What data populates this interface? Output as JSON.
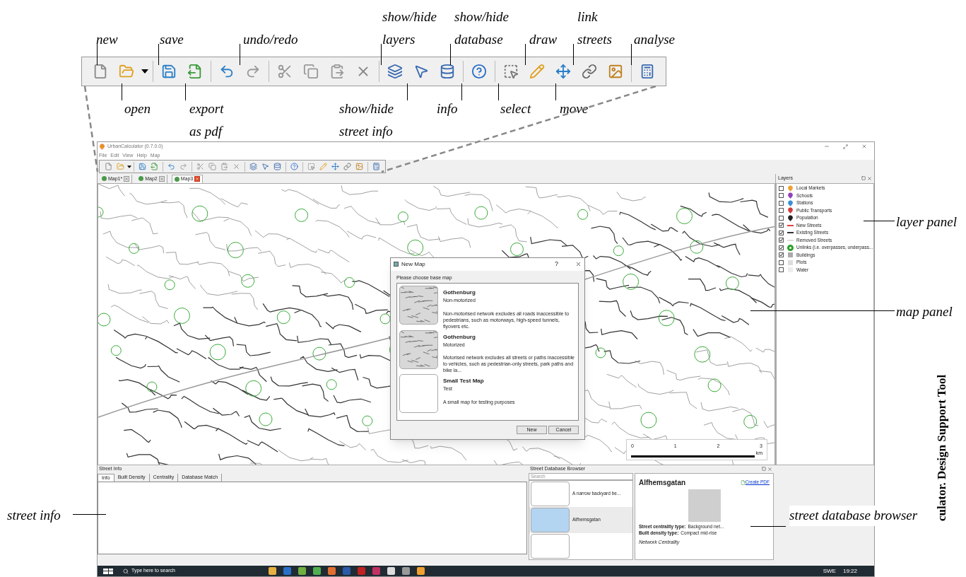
{
  "toolbar_callouts_above": [
    {
      "lines": [
        "new"
      ]
    },
    {
      "lines": [
        "save"
      ]
    },
    {
      "lines": [
        "undo/redo"
      ]
    },
    {
      "lines": [
        "show/hide",
        "layers"
      ]
    },
    {
      "lines": [
        "show/hide",
        "database"
      ]
    },
    {
      "lines": [
        "draw"
      ]
    },
    {
      "lines": [
        "link",
        "streets"
      ]
    },
    {
      "lines": [
        "analyse"
      ]
    }
  ],
  "toolbar_callouts_below": [
    {
      "lines": [
        "open"
      ]
    },
    {
      "lines": [
        "export",
        "as pdf"
      ]
    },
    {
      "lines": [
        "show/hide",
        "street info"
      ]
    },
    {
      "lines": [
        "info"
      ]
    },
    {
      "lines": [
        "select"
      ]
    },
    {
      "lines": [
        "move"
      ]
    }
  ],
  "panel_callouts": [
    "layer panel",
    "map panel",
    "street info",
    "street database browser"
  ],
  "caption": "culator. Design Support Tool",
  "window": {
    "title": "UrbanCalculator (0.7.0.0)"
  },
  "menu": [
    "File",
    "Edit",
    "View",
    "Help",
    "Map"
  ],
  "map_tabs": [
    {
      "label": "Map1*",
      "selected": false
    },
    {
      "label": "Map2",
      "selected": false
    },
    {
      "label": "Map3",
      "selected": true
    }
  ],
  "scale_bar": {
    "ticks": [
      "0",
      "1",
      "2",
      "3"
    ],
    "unit": "km"
  },
  "layers": {
    "title": "Layers",
    "items": [
      {
        "label": "Local Markets",
        "checked": false,
        "kind": "pin",
        "color": "#f0a030"
      },
      {
        "label": "Schools",
        "checked": false,
        "kind": "pin",
        "color": "#9040c0"
      },
      {
        "label": "Stations",
        "checked": false,
        "kind": "pin",
        "color": "#3a8fd8"
      },
      {
        "label": "Public Transports",
        "checked": false,
        "kind": "pin",
        "color": "#d03a3a"
      },
      {
        "label": "Population",
        "checked": false,
        "kind": "pin",
        "color": "#222222"
      },
      {
        "label": "New Streets",
        "checked": true,
        "kind": "line",
        "color": "#e04040"
      },
      {
        "label": "Existing Streets",
        "checked": true,
        "kind": "line",
        "color": "#333333"
      },
      {
        "label": "Removed Streets",
        "checked": true,
        "kind": "line",
        "color": "#dddddd"
      },
      {
        "label": "Unlinks (i.e. overpasses, underpass...",
        "checked": true,
        "kind": "circle",
        "color": "#2aa02a"
      },
      {
        "label": "Buildings",
        "checked": true,
        "kind": "square",
        "color": "#aaaaaa"
      },
      {
        "label": "Plots",
        "checked": false,
        "kind": "square",
        "color": "#dddddd"
      },
      {
        "label": "Water",
        "checked": false,
        "kind": "square",
        "color": "#eeeeee"
      }
    ]
  },
  "new_map_dialog": {
    "title": "New Map",
    "help": "?",
    "prompt": "Please choose base map",
    "options": [
      {
        "title": "Gothenburg",
        "subtitle": "Non-motorized",
        "description": "Non-motorised network excludes all roads inaccessible to pedestrians, such as motorways, high-speed tunnels, flyovers etc.",
        "has_preview": true
      },
      {
        "title": "Gothenburg",
        "subtitle": "Motorized",
        "description": "Motorised network excludes all streets or paths inaccessible to vehicles, such as pedestrian-only streets, park paths and bike la...",
        "has_preview": true
      },
      {
        "title": "Small Test Map",
        "subtitle": "Test",
        "description": "A small map for testing purposes",
        "has_preview": false
      }
    ],
    "buttons": [
      "New",
      "Cancel"
    ]
  },
  "street_info": {
    "title": "Street Info",
    "tabs": [
      {
        "label": "Info",
        "selected": true
      },
      {
        "label": "Built Density",
        "selected": false
      },
      {
        "label": "Centrality",
        "selected": false
      },
      {
        "label": "Database Match",
        "selected": false
      }
    ]
  },
  "street_database_browser": {
    "title": "Street Database Browser",
    "search": {
      "placeholder": "Search"
    },
    "items": [
      {
        "label": "A narrow backyard be...",
        "selected": false
      },
      {
        "label": "Alfhemsgatan",
        "selected": true
      },
      {
        "selected": false
      }
    ],
    "detail": {
      "heading": "Alfhemsgatan",
      "link": "Create PDF",
      "fields": [
        {
          "label": "Street centrality type:",
          "value": "Background net..."
        },
        {
          "label": "Built density type:",
          "value": "Compact mid-rise"
        }
      ],
      "section": "Network Centrality"
    }
  },
  "taskbar": {
    "search": {
      "placeholder": "Type here to search"
    },
    "language": "SWE",
    "time": "19:22"
  }
}
